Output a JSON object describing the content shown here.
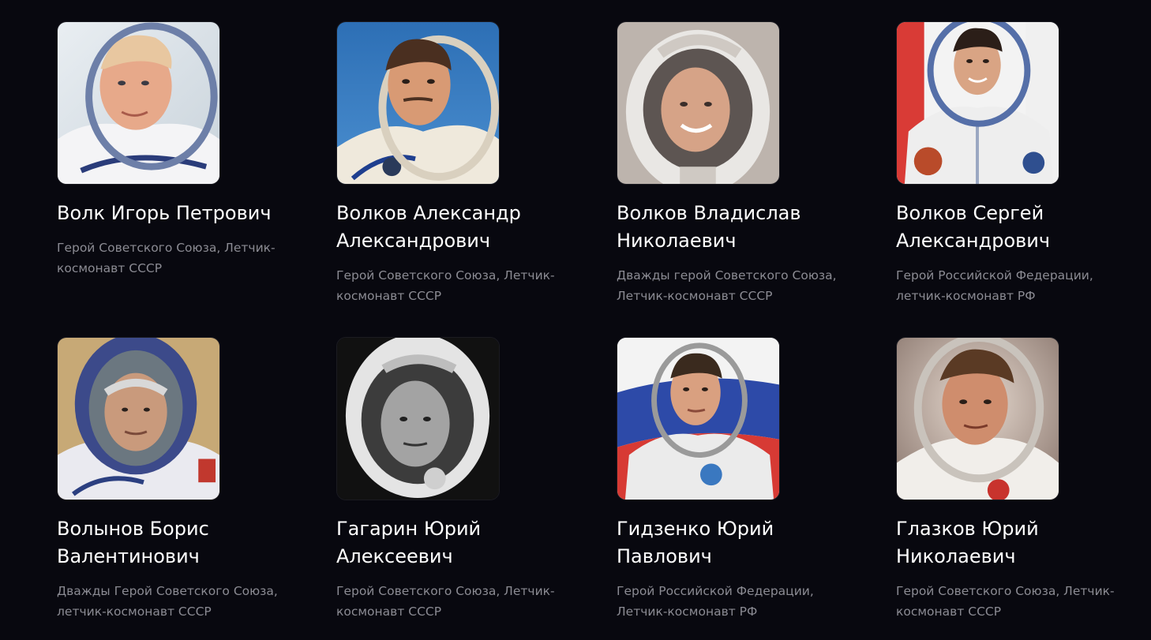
{
  "cosmonauts": [
    {
      "name": "Волк Игорь Петрович",
      "title": "Герой Советского Союза, Летчик-космонавт СССР"
    },
    {
      "name": "Волков Александр Александрович",
      "title": "Герой Советского Союза, Летчик-космонавт СССР"
    },
    {
      "name": "Волков Владислав Николаевич",
      "title": "Дважды герой Советского Союза, Летчик-космонавт СССР"
    },
    {
      "name": "Волков Сергей Александрович",
      "title": "Герой Российской Федерации, летчик-космонавт РФ"
    },
    {
      "name": "Волынов Борис Валентинович",
      "title": "Дважды Герой Советского Союза, летчик-космонавт СССР"
    },
    {
      "name": "Гагарин Юрий Алексеевич",
      "title": "Герой Советского Союза, Летчик-космонавт СССР"
    },
    {
      "name": "Гидзенко Юрий Павлович",
      "title": "Герой Российской Федерации, Летчик-космонавт РФ"
    },
    {
      "name": "Глазков Юрий Николаевич",
      "title": "Герой Советского Союза, Летчик-космонавт СССР"
    }
  ],
  "colors": {
    "background": "#08080f",
    "name_text": "#ffffff",
    "title_text": "#8b8b93"
  }
}
